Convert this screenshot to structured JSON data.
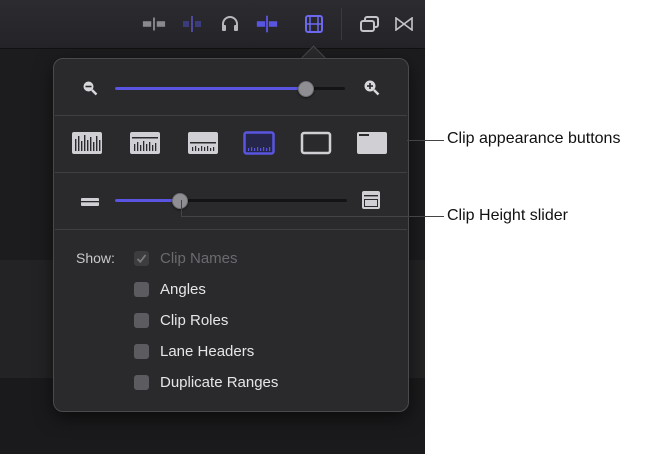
{
  "colors": {
    "accent": "#5a55e0",
    "popover_bg": "#2a2a2d",
    "app_bg": "#1b1b1d"
  },
  "toolbar": {
    "icons": [
      "blade-icon",
      "skimming-icon",
      "headphones-icon",
      "snapping-icon",
      "clip-appearance-icon",
      "timeline-index-icon",
      "transitions-icon"
    ]
  },
  "zoom_slider": {
    "value": 0.83,
    "min_icon": "zoom-out-icon",
    "max_icon": "zoom-in-icon"
  },
  "clip_appearance": {
    "buttons": [
      {
        "icon": "waveform-only-icon",
        "selected": false
      },
      {
        "icon": "large-waveform-icon",
        "selected": false
      },
      {
        "icon": "equal-waveform-icon",
        "selected": false
      },
      {
        "icon": "small-waveform-icon",
        "selected": true
      },
      {
        "icon": "filmstrip-only-icon",
        "selected": false
      },
      {
        "icon": "labels-only-icon",
        "selected": false
      }
    ]
  },
  "height_slider": {
    "value": 0.28,
    "min_icon": "short-clip-icon",
    "max_icon": "tall-clip-icon"
  },
  "show": {
    "label": "Show:",
    "options": [
      {
        "label": "Clip Names",
        "checked": true,
        "disabled": true
      },
      {
        "label": "Angles",
        "checked": false,
        "disabled": false
      },
      {
        "label": "Clip Roles",
        "checked": false,
        "disabled": false
      },
      {
        "label": "Lane Headers",
        "checked": false,
        "disabled": false
      },
      {
        "label": "Duplicate Ranges",
        "checked": false,
        "disabled": false
      }
    ]
  },
  "callouts": {
    "appearance": "Clip appearance buttons",
    "height": "Clip Height slider"
  }
}
